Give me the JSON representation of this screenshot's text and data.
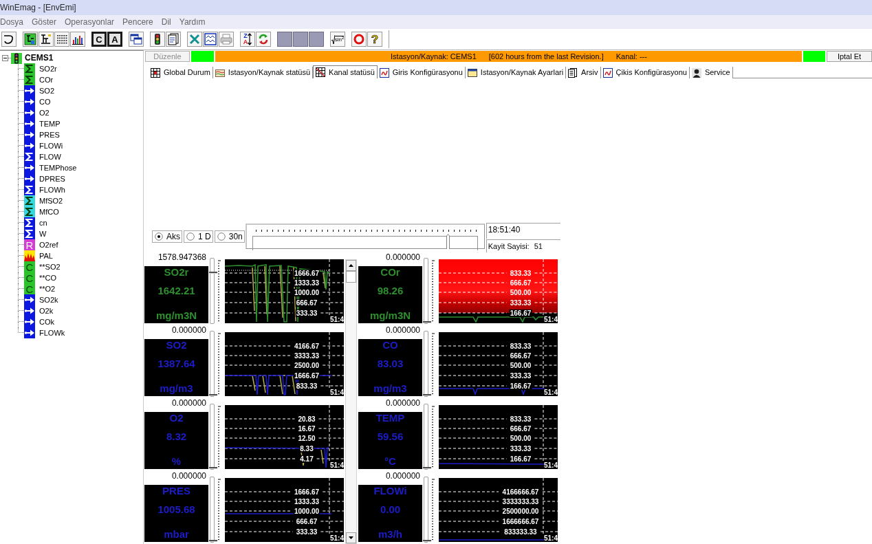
{
  "window": {
    "title": "WinEmag - [EnvEmi]"
  },
  "menu": [
    "Dosya",
    "Göster",
    "Operasyonlar",
    "Pencere",
    "Dil",
    "Yardım"
  ],
  "toolbar": [
    [
      {
        "kind": "curve"
      }
    ],
    [
      {
        "kind": "diagram"
      },
      {
        "kind": "branch"
      },
      {
        "kind": "dots"
      },
      {
        "kind": "bars"
      }
    ],
    [
      {
        "kind": "drive",
        "glyph": "C"
      },
      {
        "kind": "drive",
        "glyph": "A"
      }
    ],
    [
      {
        "kind": "windows"
      }
    ],
    [
      {
        "kind": "lights"
      },
      {
        "kind": "document"
      }
    ],
    [
      {
        "kind": "cross"
      },
      {
        "kind": "graph"
      },
      {
        "kind": "printer"
      }
    ],
    [
      {
        "kind": "sort",
        "glyphs": [
          "Z",
          "A"
        ]
      },
      {
        "kind": "refresh"
      }
    ],
    [
      {
        "kind": "blank"
      },
      {
        "kind": "blank"
      },
      {
        "kind": "blank"
      }
    ],
    [
      {
        "kind": "formula",
        "glyph": "sin$^{2}$"
      }
    ],
    [
      {
        "kind": "stop"
      },
      {
        "kind": "help",
        "glyph": "?"
      }
    ]
  ],
  "tree": {
    "label": "CEMS1",
    "expanded": true,
    "children": [
      {
        "label": "SO2r",
        "kind": "sum",
        "color": "#2bc42b"
      },
      {
        "label": "COr",
        "kind": "sum",
        "color": "#2bc42b"
      },
      {
        "label": "SO2",
        "kind": "input",
        "color": "#0c18e0"
      },
      {
        "label": "CO",
        "kind": "input",
        "color": "#0c18e0"
      },
      {
        "label": "O2",
        "kind": "input",
        "color": "#0c18e0"
      },
      {
        "label": "TEMP",
        "kind": "input",
        "color": "#0c18e0"
      },
      {
        "label": "PRES",
        "kind": "input",
        "color": "#0c18e0"
      },
      {
        "label": "FLOWi",
        "kind": "input",
        "color": "#0c18e0"
      },
      {
        "label": "FLOW",
        "kind": "sum",
        "color": "#0c18e0"
      },
      {
        "label": "TEMPhose",
        "kind": "input",
        "color": "#0c18e0"
      },
      {
        "label": "DPRES",
        "kind": "input",
        "color": "#0c18e0"
      },
      {
        "label": "FLOWh",
        "kind": "sum",
        "color": "#0c18e0"
      },
      {
        "label": "MfSO2",
        "kind": "sum",
        "color": "#36d8e0"
      },
      {
        "label": "MfCO",
        "kind": "sum",
        "color": "#36d8e0"
      },
      {
        "label": "cn",
        "kind": "sum",
        "color": "#0c18e0"
      },
      {
        "label": "W",
        "kind": "sum",
        "color": "#0c18e0"
      },
      {
        "label": "O2ref",
        "kind": "letter",
        "glyph": "R",
        "color": "#d43cd4"
      },
      {
        "label": "PAL",
        "kind": "alarm",
        "color": "#ffe600"
      },
      {
        "label": "**SO2",
        "kind": "letter",
        "glyph": "C",
        "color": "#2bc42b"
      },
      {
        "label": "**CO",
        "kind": "letter",
        "glyph": "C",
        "color": "#2bc42b"
      },
      {
        "label": "**O2",
        "kind": "letter",
        "glyph": "C",
        "color": "#2bc42b"
      },
      {
        "label": "SO2k",
        "kind": "input",
        "color": "#0c18e0"
      },
      {
        "label": "O2k",
        "kind": "input",
        "color": "#0c18e0"
      },
      {
        "label": "COk",
        "kind": "input",
        "color": "#0c18e0"
      },
      {
        "label": "FLOWk",
        "kind": "input",
        "color": "#0c18e0"
      }
    ]
  },
  "status_bar": {
    "edit_button": {
      "label": "Düzenle",
      "disabled": true
    },
    "left_lamp": {
      "color": "#00ff00"
    },
    "message": [
      "Istasyon/Kaynak: CEMS1",
      "[602 hours from the last Revision.]",
      "Kanal: ---"
    ],
    "right_lamp": {
      "color": "#00ff00"
    },
    "cancel_button": {
      "label": "Iptal Et"
    }
  },
  "tabs": [
    {
      "label": "Global Durum",
      "selected": false
    },
    {
      "label": "Istasyon/Kaynak statüsü",
      "selected": false
    },
    {
      "label": "Kanal statüsü",
      "selected": true
    },
    {
      "label": "Giris Konfigürasyonu",
      "selected": false
    },
    {
      "label": "Istasyon/Kaynak Ayarlari",
      "selected": false
    },
    {
      "label": "Arsiv",
      "selected": false
    },
    {
      "label": "Çikis Konfigürasyonu",
      "selected": false
    },
    {
      "label": "Service",
      "selected": false
    }
  ],
  "range_options": [
    {
      "label": "Aks",
      "selected": true
    },
    {
      "label": "1 D",
      "selected": false
    },
    {
      "label": "30n",
      "selected": false
    }
  ],
  "timeline": {
    "level": 0.866
  },
  "time": "18:51:40",
  "record_count": {
    "label": "Kayit Sayisi:",
    "value": "51"
  },
  "channels": [
    {
      "name": "SO2r",
      "value": "1642.21",
      "unit": "mg/m3N",
      "top_label": "1578.947368",
      "level": 0.8,
      "color": "#2e8f2e",
      "alarm": false,
      "gridlines": [
        "1666.67",
        "1333.33",
        "1000.00",
        "666.67",
        "333.33"
      ],
      "time": "51:4"
    },
    {
      "name": "COr",
      "value": "98.26",
      "unit": "mg/m3N",
      "top_label": "0.000000",
      "level": 0,
      "color": "#2e8f2e",
      "alarm": true,
      "gridlines": [
        "833.33",
        "666.67",
        "500.00",
        "333.33",
        "166.67"
      ],
      "time": "51:4"
    },
    {
      "name": "SO2",
      "value": "1387.64",
      "unit": "mg/m3",
      "top_label": "0.000000",
      "level": 0,
      "color": "#1c1cc8",
      "alarm": false,
      "gridlines": [
        "4166.67",
        "3333.33",
        "2500.00",
        "1666.67",
        "833.33"
      ],
      "time": "51:4"
    },
    {
      "name": "CO",
      "value": "83.03",
      "unit": "mg/m3",
      "top_label": "0.000000",
      "level": 0,
      "color": "#1c1cc8",
      "alarm": false,
      "gridlines": [
        "833.33",
        "666.67",
        "500.00",
        "333.33",
        "166.67"
      ],
      "time": "51:4"
    },
    {
      "name": "O2",
      "value": "8.32",
      "unit": "%",
      "top_label": "0.000000",
      "level": 0,
      "color": "#1c1cc8",
      "alarm": false,
      "gridlines": [
        "20.83",
        "16.67",
        "12.50",
        "8.33",
        "4.17"
      ],
      "time": "51:4"
    },
    {
      "name": "TEMP",
      "value": "59.56",
      "unit": "°C",
      "top_label": "0.000000",
      "level": 0,
      "color": "#1c1cc8",
      "alarm": false,
      "gridlines": [
        "833.33",
        "666.67",
        "500.00",
        "333.33",
        "166.67"
      ],
      "time": "51:4"
    },
    {
      "name": "PRES",
      "value": "1005.68",
      "unit": "mbar",
      "top_label": "0.000000",
      "level": 0,
      "color": "#1c1cc8",
      "alarm": false,
      "gridlines": [
        "1666.67",
        "1333.33",
        "1000.00",
        "666.67",
        "333.33"
      ],
      "time": "51:4"
    },
    {
      "name": "FLOWi",
      "value": "0.00",
      "unit": "m3/h",
      "top_label": "0.000000",
      "level": 0,
      "color": "#1c1cc8",
      "alarm": false,
      "gridlines": [
        "4166666.67",
        "3333333.33",
        "2500000.00",
        "1666666.67",
        "833333.33"
      ],
      "time": "51:4"
    }
  ]
}
